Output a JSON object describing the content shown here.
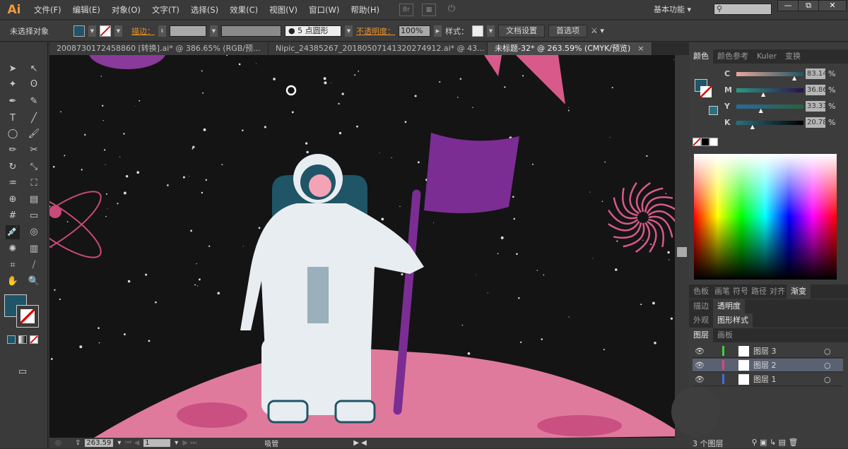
{
  "app": {
    "logo": "Ai",
    "menu": [
      "文件(F)",
      "编辑(E)",
      "对象(O)",
      "文字(T)",
      "选择(S)",
      "效果(C)",
      "视图(V)",
      "窗口(W)",
      "帮助(H)"
    ],
    "bridge": "Br",
    "workspace": "基本功能",
    "search_placeholder": "",
    "win": [
      "—",
      "⧉",
      "✕"
    ]
  },
  "control": {
    "selection": "未选择对象",
    "stroke_label": "描边：",
    "brush": "5 点圆形",
    "opacity_label": "不透明度：",
    "opacity": "100%",
    "style_label": "样式：",
    "doc_setup": "文档设置",
    "prefs": "首选项"
  },
  "tabs": [
    {
      "label": "20087301724588​60 [转换].ai* @ 386.65% (RGB/预...",
      "close": "×"
    },
    {
      "label": "Nipic_24385267_20180507141320274912.ai* @ 43...",
      "close": "×"
    },
    {
      "label": "未标题-32* @ 263.59% (CMYK/预览)",
      "close": "×"
    }
  ],
  "status": {
    "zoom": "263.59",
    "page": "1",
    "tool": "吸管"
  },
  "color_panel": {
    "tabs": [
      "颜色",
      "颜色参考",
      "Kuler",
      "变换"
    ],
    "channels": [
      {
        "label": "C",
        "value": "83.14",
        "pct": 83.14
      },
      {
        "label": "M",
        "value": "36.86",
        "pct": 36.86
      },
      {
        "label": "Y",
        "value": "33.33",
        "pct": 33.33
      },
      {
        "label": "K",
        "value": "20.78",
        "pct": 20.78
      }
    ],
    "unit": "%",
    "fill": "#1f5566"
  },
  "panel2": {
    "tabs": [
      "色板",
      "画笔",
      "符号",
      "路径",
      "对齐",
      "渐变"
    ]
  },
  "panel3": {
    "tabs": [
      "描边",
      "透明度"
    ]
  },
  "panel4": {
    "tabs": [
      "外观",
      "图形样式"
    ]
  },
  "layers": {
    "tabs": [
      "图层",
      "画板"
    ],
    "items": [
      {
        "name": "图层 3",
        "color": "#3fd23f"
      },
      {
        "name": "图层 2",
        "color": "#e04090"
      },
      {
        "name": "图层 1",
        "color": "#4070e0"
      }
    ],
    "count": "3 个图层"
  }
}
